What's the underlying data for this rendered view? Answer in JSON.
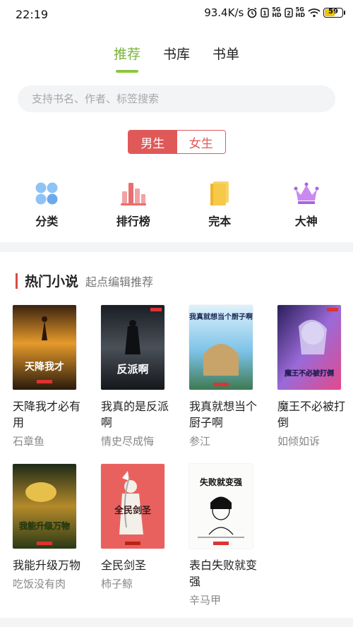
{
  "status": {
    "time": "22:19",
    "net_speed": "93.4K/s",
    "sim1": "5G\nHD",
    "sim2": "5G\nHD",
    "battery": "59"
  },
  "tabs": [
    {
      "label": "推荐",
      "active": true
    },
    {
      "label": "书库",
      "active": false
    },
    {
      "label": "书单",
      "active": false
    }
  ],
  "search": {
    "placeholder": "支持书名、作者、标签搜索"
  },
  "gender": {
    "male": "男生",
    "female": "女生",
    "selected": "male"
  },
  "categories": [
    {
      "label": "分类",
      "icon": "grid-icon"
    },
    {
      "label": "排行榜",
      "icon": "chart-bar-icon"
    },
    {
      "label": "完本",
      "icon": "book-icon"
    },
    {
      "label": "大神",
      "icon": "crown-icon"
    }
  ],
  "section": {
    "title": "热门小说",
    "subtitle": "起点编辑推荐"
  },
  "books": [
    {
      "title": "天降我才必有用",
      "author": "石章鱼",
      "cover_text": "天降我才"
    },
    {
      "title": "我真的是反派啊",
      "author": "情史尽成悔",
      "cover_text": "反派啊"
    },
    {
      "title": "我真就想当个厨子啊",
      "author": "参江",
      "cover_text": "我真就想当个厨子啊"
    },
    {
      "title": "魔王不必被打倒",
      "author": "如倾如诉",
      "cover_text": "魔王不必被打倒"
    },
    {
      "title": "我能升级万物",
      "author": "吃饭没有肉",
      "cover_text": "我能升级万物"
    },
    {
      "title": "全民剑圣",
      "author": "柿子鲸",
      "cover_text": "全民剑圣"
    },
    {
      "title": "表白失败就变强",
      "author": "辛马甲",
      "cover_text": "失败就变强"
    }
  ],
  "colors": {
    "accent_green": "#8dc63f",
    "accent_red": "#e05959"
  }
}
